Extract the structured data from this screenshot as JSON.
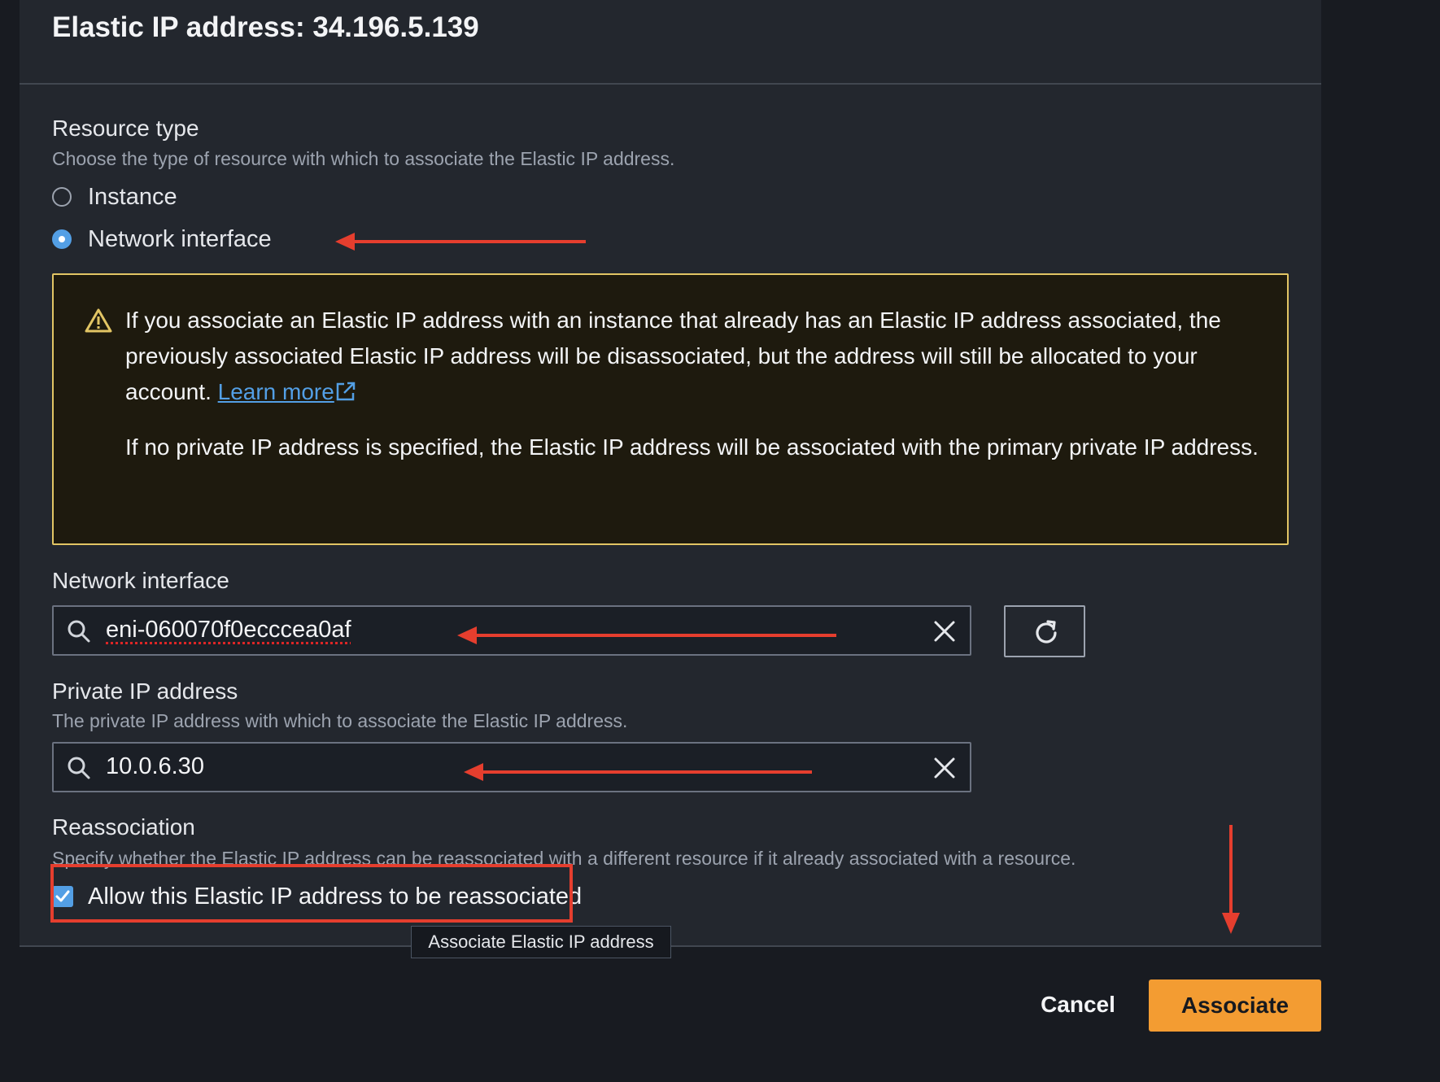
{
  "dialog": {
    "title": "Elastic IP address: 34.196.5.139"
  },
  "resource_type": {
    "label": "Resource type",
    "description": "Choose the type of resource with which to associate the Elastic IP address.",
    "options": [
      {
        "label": "Instance",
        "selected": false
      },
      {
        "label": "Network interface",
        "selected": true
      }
    ]
  },
  "alert": {
    "icon": "warning-icon",
    "color": "#e2c564",
    "text_1": "If you associate an Elastic IP address with an instance that already has an Elastic IP address associated, the previously associated Elastic IP address will be disassociated, but the address will still be allocated to your account.",
    "link_label": "Learn more",
    "text_2": "If no private IP address is specified, the Elastic IP address will be associated with the primary private IP address."
  },
  "network_interface": {
    "label": "Network interface",
    "value": "eni-060070f0ecccea0af",
    "icons": [
      "search-icon",
      "close-icon",
      "refresh-icon"
    ]
  },
  "private_ip": {
    "label": "Private IP address",
    "description": "The private IP address with which to associate the Elastic IP address.",
    "value": "10.0.6.30"
  },
  "reassociation": {
    "label": "Reassociation",
    "description": "Specify whether the Elastic IP address can be reassociated with a different resource if it already associated with a resource.",
    "checkbox_label": "Allow this Elastic IP address to be reassociated",
    "checked": true
  },
  "tooltip": {
    "text": "Associate Elastic IP address"
  },
  "footer": {
    "cancel_label": "Cancel",
    "associate_label": "Associate"
  },
  "colors": {
    "accent": "#539fe5",
    "primary_button": "#f39c32",
    "annotation": "#e53e2e",
    "warning": "#e2c564"
  }
}
